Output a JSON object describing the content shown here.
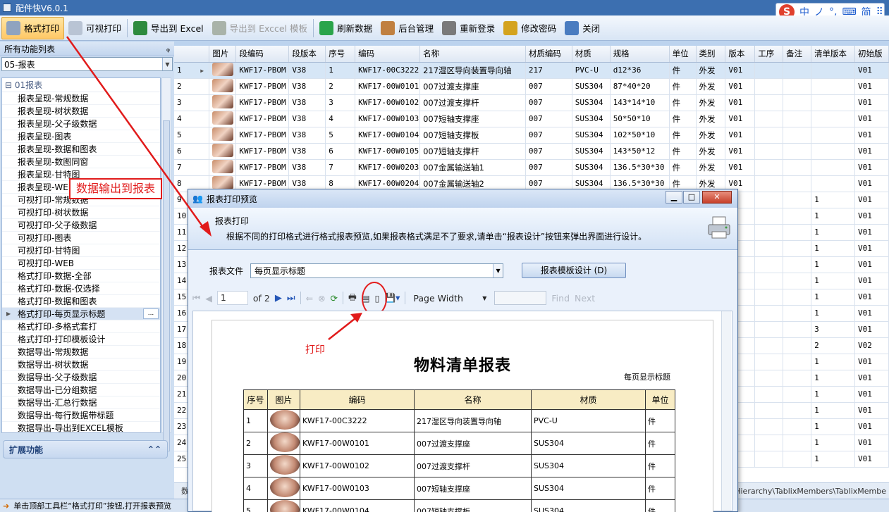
{
  "app": {
    "title": "配件快V6.0.1"
  },
  "ime": {
    "brand": "S",
    "items": [
      "中",
      "ノ",
      "°,",
      "⌨",
      "简",
      "⠿"
    ]
  },
  "toolbar": [
    {
      "label": "格式打印",
      "icon": "printer-icon",
      "state": "active"
    },
    {
      "label": "可视打印",
      "icon": "print-preview-icon",
      "state": "normal"
    },
    {
      "label": "导出到 Excel",
      "icon": "excel-icon",
      "state": "normal"
    },
    {
      "label": "导出到 Exccel 模板",
      "icon": "excel-template-icon",
      "state": "disabled"
    },
    {
      "label": "刷新数据",
      "icon": "refresh-icon",
      "state": "normal"
    },
    {
      "label": "后台管理",
      "icon": "admin-icon",
      "state": "normal"
    },
    {
      "label": "重新登录",
      "icon": "lock-icon",
      "state": "normal"
    },
    {
      "label": "修改密码",
      "icon": "key-icon",
      "state": "normal"
    },
    {
      "label": "关闭",
      "icon": "exit-icon",
      "state": "normal"
    }
  ],
  "left_panel": {
    "header": "所有功能列表",
    "pin": "ᵩ",
    "module_value": "05-报表",
    "group": "01报表",
    "items": [
      "报表呈现-常规数据",
      "报表呈现-树状数据",
      "报表呈现-父子级数据",
      "报表呈现-图表",
      "报表呈现-数据和图表",
      "报表呈现-数图同窗",
      "报表呈现-甘特图",
      "报表呈现-WEB",
      "可视打印-常规数据",
      "可视打印-树状数据",
      "可视打印-父子级数据",
      "可视打印-图表",
      "可视打印-甘特图",
      "可视打印-WEB",
      "格式打印-数据-全部",
      "格式打印-数据-仅选择",
      "格式打印-数据和图表",
      "格式打印-每页显示标题",
      "格式打印-多格式套打",
      "格式打印-打印模板设计",
      "数据导出-常规数据",
      "数据导出-树状数据",
      "数据导出-父子级数据",
      "数据导出-已分组数据",
      "数据导出-汇总行数据",
      "数据导出-每行数据带标题",
      "数据导出-导出到EXCEL模板"
    ],
    "selected_index": 17,
    "ellipsis": "...",
    "extension_label": "扩展功能",
    "extension_arrow": "⌃⌃"
  },
  "grid": {
    "columns": [
      "",
      "图片",
      "段编码",
      "段版本",
      "序号",
      "编码",
      "名称",
      "材质编码",
      "材质",
      "规格",
      "单位",
      "类别",
      "版本",
      "工序",
      "备注",
      "清单版本",
      "初始版"
    ],
    "rows": [
      [
        "1",
        "KWF17-PBOM",
        "V38",
        "1",
        "KWF17-00C3222",
        "217湿区导向装置导向轴",
        "217",
        "PVC-U",
        "d12*36",
        "件",
        "外发",
        "V01",
        "",
        "",
        "",
        "V01"
      ],
      [
        "2",
        "KWF17-PBOM",
        "V38",
        "2",
        "KWF17-00W0101",
        "007过渡支撑座",
        "007",
        "SUS304",
        "87*40*20",
        "件",
        "外发",
        "V01",
        "",
        "",
        "",
        "V01"
      ],
      [
        "3",
        "KWF17-PBOM",
        "V38",
        "3",
        "KWF17-00W0102",
        "007过渡支撑杆",
        "007",
        "SUS304",
        "143*14*10",
        "件",
        "外发",
        "V01",
        "",
        "",
        "",
        "V01"
      ],
      [
        "4",
        "KWF17-PBOM",
        "V38",
        "4",
        "KWF17-00W0103",
        "007短轴支撑座",
        "007",
        "SUS304",
        "50*50*10",
        "件",
        "外发",
        "V01",
        "",
        "",
        "",
        "V01"
      ],
      [
        "5",
        "KWF17-PBOM",
        "V38",
        "5",
        "KWF17-00W0104",
        "007短轴支撑板",
        "007",
        "SUS304",
        "102*50*10",
        "件",
        "外发",
        "V01",
        "",
        "",
        "",
        "V01"
      ],
      [
        "6",
        "KWF17-PBOM",
        "V38",
        "6",
        "KWF17-00W0105",
        "007短轴支撑杆",
        "007",
        "SUS304",
        "143*50*12",
        "件",
        "外发",
        "V01",
        "",
        "",
        "",
        "V01"
      ],
      [
        "7",
        "KWF17-PBOM",
        "V38",
        "7",
        "KWF17-00W0203",
        "007金属输送轴1",
        "007",
        "SUS304",
        "136.5*30*30",
        "件",
        "外发",
        "V01",
        "",
        "",
        "",
        "V01"
      ],
      [
        "8",
        "KWF17-PBOM",
        "V38",
        "8",
        "KWF17-00W0204",
        "007金属输送轴2",
        "007",
        "SUS304",
        "136.5*30*30",
        "件",
        "外发",
        "V01",
        "",
        "",
        "",
        "V01"
      ]
    ],
    "extra_row_numbers": [
      "9",
      "10",
      "11",
      "12",
      "13",
      "14",
      "15",
      "16",
      "17",
      "18",
      "19",
      "20",
      "21",
      "22",
      "23",
      "24",
      "25"
    ],
    "extra_right_values": [
      "1",
      "1",
      "1",
      "1",
      "1",
      "1",
      "1",
      "1",
      "3",
      "2",
      "1",
      "1",
      "1",
      "1",
      "1",
      "1",
      "1"
    ],
    "extra_last_values": [
      "V01",
      "V01",
      "V01",
      "V01",
      "V01",
      "V01",
      "V01",
      "V01",
      "V01",
      "V02",
      "V01",
      "V01",
      "V01",
      "V01",
      "V01",
      "V01",
      "V01"
    ],
    "bottom_row_label": "数",
    "hscroll_text": "wHierarchy\\TablixMembers\\TablixMembe"
  },
  "status": {
    "text": "单击顶部工具栏“格式打印”按钮,打开报表预览"
  },
  "dialog": {
    "title": "报表打印预览",
    "head_title": "报表打印",
    "head_desc": "根据不同的打印格式进行格式报表预览,如果报表格式满足不了要求,请单击“报表设计”按钮来弹出界面进行设计。",
    "file_label": "报表文件",
    "file_value": "每页显示标题",
    "design_button": "报表模板设计 (D)",
    "page_value": "1",
    "page_of": "of 2",
    "zoom_value": "Page Width",
    "find_label": "Find",
    "next_label": "Next"
  },
  "report": {
    "title": "物料清单报表",
    "subtitle": "每页显示标题",
    "columns": [
      "序号",
      "图片",
      "编码",
      "名称",
      "材质",
      "单位"
    ],
    "rows": [
      [
        "1",
        "KWF17-00C3222",
        "217湿区导向装置导向轴",
        "PVC-U",
        "件"
      ],
      [
        "2",
        "KWF17-00W0101",
        "007过渡支撑座",
        "SUS304",
        "件"
      ],
      [
        "3",
        "KWF17-00W0102",
        "007过渡支撑杆",
        "SUS304",
        "件"
      ],
      [
        "4",
        "KWF17-00W0103",
        "007短轴支撑座",
        "SUS304",
        "件"
      ],
      [
        "5",
        "KWF17-00W0104",
        "007短轴支撑板",
        "SUS304",
        "件"
      ]
    ]
  },
  "annotations": {
    "output_to_report": "数据输出到报表",
    "print": "打印"
  },
  "colors": {
    "annotation_red": "#e11b1b",
    "header_blue": "#3c6fb0",
    "active_toolbar": "#ffc866"
  }
}
